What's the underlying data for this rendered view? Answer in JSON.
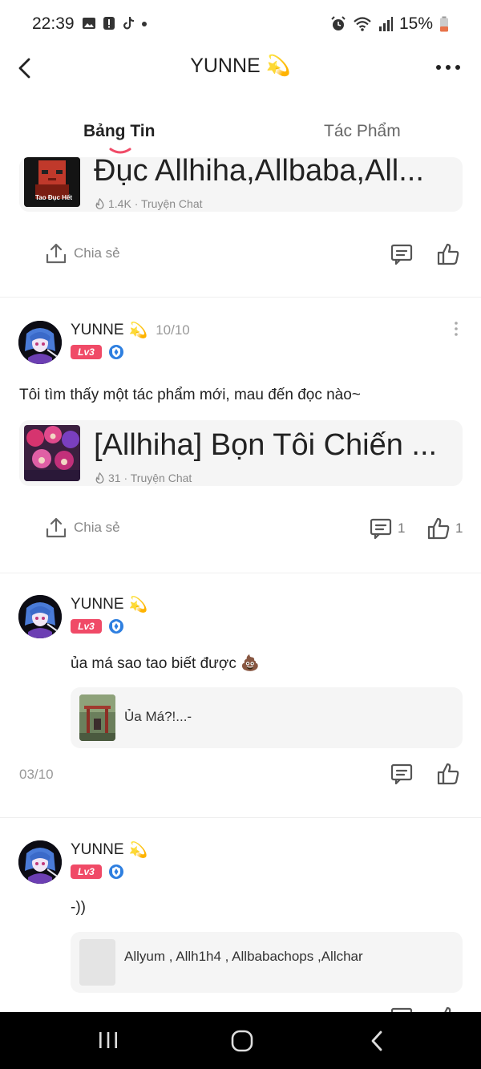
{
  "status_bar": {
    "time": "22:39",
    "battery": "15%"
  },
  "header": {
    "title": "YUNNE",
    "title_emoji": "💫"
  },
  "tabs": [
    {
      "label": "Bảng Tin",
      "active": true
    },
    {
      "label": "Tác Phẩm",
      "active": false
    }
  ],
  "posts": [
    {
      "card": {
        "title": "Đục Allhiha,Allbaba,All...",
        "meta": "1.4K · Truyện Chat",
        "thumb_text": "Tao Đục Hết"
      },
      "share_label": "Chia sẻ"
    },
    {
      "author": "YUNNE",
      "author_emoji": "💫",
      "date": "10/10",
      "level": "Lv3",
      "text": "Tôi tìm thấy một tác phẩm mới, mau đến đọc nào~",
      "card": {
        "title": "[Allhiha] Bọn Tôi Chiến ...",
        "meta": "31 · Truyện Chat"
      },
      "share_label": "Chia sẻ",
      "comment_count": "1",
      "like_count": "1"
    },
    {
      "author": "YUNNE",
      "author_emoji": "💫",
      "level": "Lv3",
      "text": "ủa má sao tao biết được 💩",
      "ref_text": "Ủa Má?!...-",
      "date": "03/10"
    },
    {
      "author": "YUNNE",
      "author_emoji": "💫",
      "level": "Lv3",
      "text": "-))",
      "ref_text": "Allyum , Allh1h4 , Allbabachops ,Allchar"
    }
  ],
  "colors": {
    "accent": "#f04a67",
    "level_badge": "#f04a67",
    "shield": "#2e7fe0",
    "card_bg": "#f5f5f5"
  }
}
